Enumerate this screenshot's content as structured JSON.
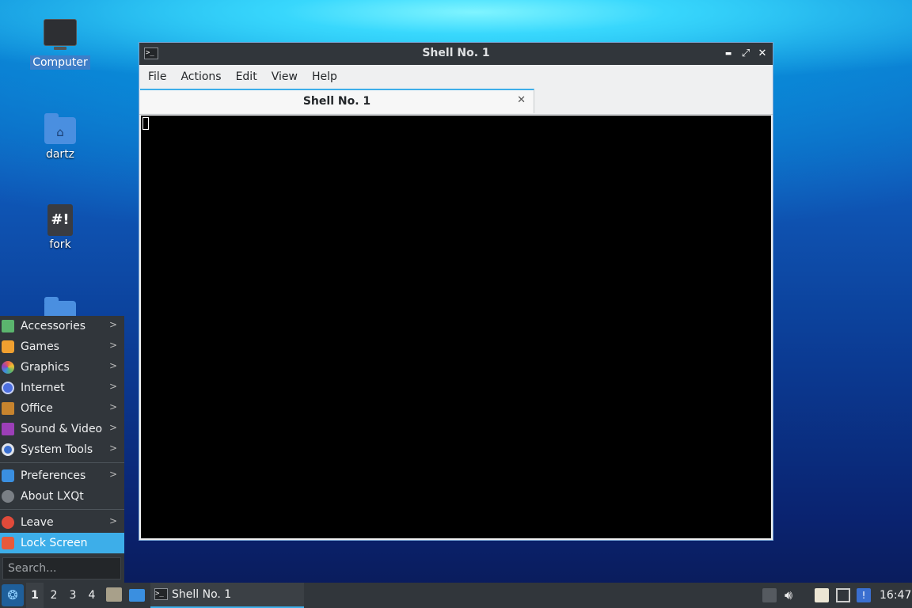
{
  "desktop": {
    "icons": [
      {
        "label": "Computer",
        "icon": "monitor-icon"
      },
      {
        "label": "dartz",
        "icon": "home-folder-icon"
      },
      {
        "label": "fork",
        "icon": "script-icon"
      },
      {
        "label": "",
        "icon": "folder-icon"
      }
    ]
  },
  "window": {
    "title": "Shell No. 1",
    "buttons": {
      "minimize": "▬",
      "maximize": "⤢",
      "close": "✕"
    },
    "menu": [
      "File",
      "Actions",
      "Edit",
      "View",
      "Help"
    ],
    "tab": {
      "label": "Shell No. 1",
      "close": "✕"
    }
  },
  "start_menu": {
    "items": [
      {
        "label": "Accessories",
        "icon": "accessories-icon",
        "color": "#5bb56e",
        "submenu": true
      },
      {
        "label": "Games",
        "icon": "games-icon",
        "color": "#f0a030",
        "submenu": true
      },
      {
        "label": "Graphics",
        "icon": "graphics-icon",
        "color": "#e8604c",
        "submenu": true
      },
      {
        "label": "Internet",
        "icon": "internet-icon",
        "color": "#4d6fe0",
        "submenu": true
      },
      {
        "label": "Office",
        "icon": "office-icon",
        "color": "#c7842e",
        "submenu": true
      },
      {
        "label": "Sound & Video",
        "icon": "sound-video-icon",
        "color": "#9c3fb8",
        "submenu": true
      },
      {
        "label": "System Tools",
        "icon": "system-tools-icon",
        "color": "#3a6fd0",
        "submenu": true
      },
      {
        "label": "Preferences",
        "icon": "preferences-icon",
        "color": "#3a8fe0",
        "submenu": true
      },
      {
        "label": "About LXQt",
        "icon": "info-icon",
        "color": "#7a7f85",
        "submenu": false
      },
      {
        "label": "Leave",
        "icon": "power-icon",
        "color": "#e04a3a",
        "submenu": true
      },
      {
        "label": "Lock Screen",
        "icon": "lock-icon",
        "color": "#e85a3a",
        "submenu": false
      }
    ],
    "search_placeholder": "Search..."
  },
  "taskbar": {
    "desktops": [
      "1",
      "2",
      "3",
      "4"
    ],
    "task_label": "Shell No. 1",
    "clock": "16:47"
  },
  "colors": {
    "accent": "#3daee9",
    "panel": "#31363b"
  }
}
